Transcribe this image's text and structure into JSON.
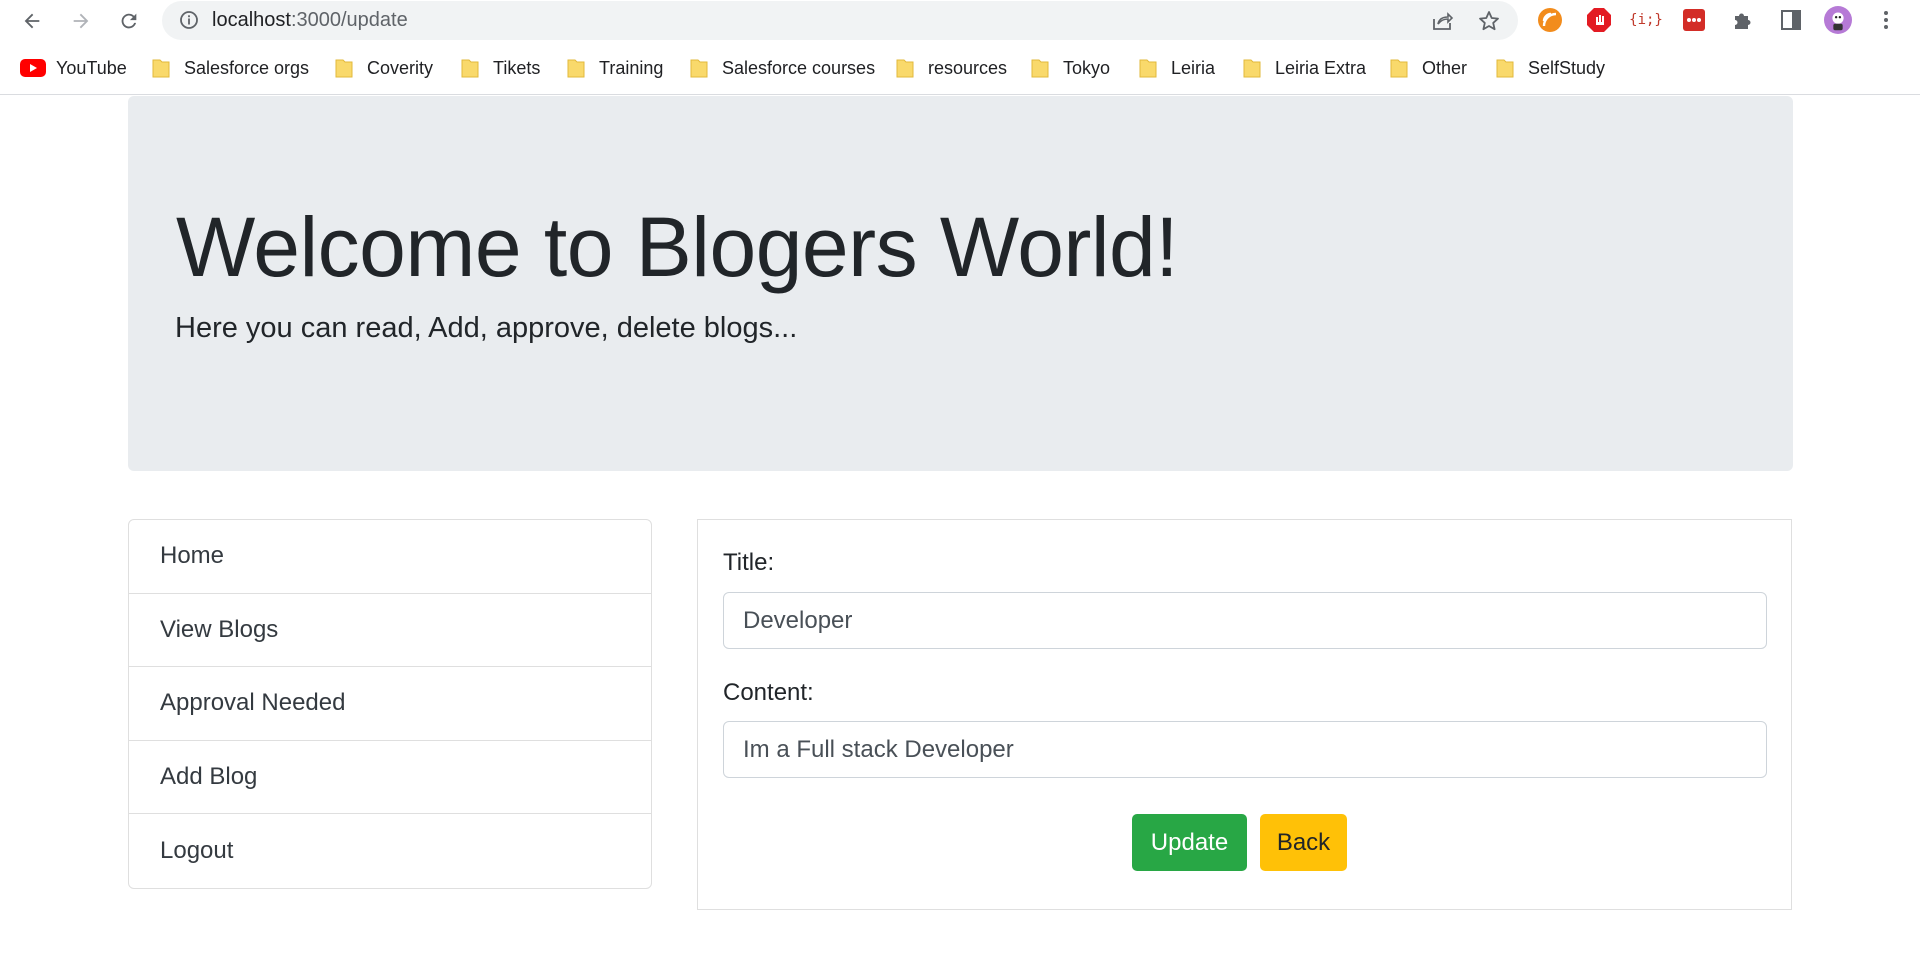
{
  "browser": {
    "url_host": "localhost",
    "url_path": ":3000/update",
    "bookmarks": [
      {
        "label": "YouTube",
        "icon": "youtube-icon"
      },
      {
        "label": "Salesforce orgs",
        "icon": "folder-icon"
      },
      {
        "label": "Coverity",
        "icon": "folder-icon"
      },
      {
        "label": "Tikets",
        "icon": "folder-icon"
      },
      {
        "label": "Training",
        "icon": "folder-icon"
      },
      {
        "label": "Salesforce courses",
        "icon": "folder-icon"
      },
      {
        "label": "resources",
        "icon": "folder-icon"
      },
      {
        "label": "Tokyo",
        "icon": "folder-icon"
      },
      {
        "label": "Leiria",
        "icon": "folder-icon"
      },
      {
        "label": "Leiria Extra",
        "icon": "folder-icon"
      },
      {
        "label": "Other",
        "icon": "folder-icon"
      },
      {
        "label": "SelfStudy",
        "icon": "folder-icon"
      }
    ],
    "extension_text": "{i;}"
  },
  "jumbotron": {
    "title": "Welcome to Blogers World!",
    "subtitle": "Here you can read, Add, approve, delete blogs..."
  },
  "sidebar": {
    "items": [
      {
        "label": "Home"
      },
      {
        "label": "View Blogs"
      },
      {
        "label": "Approval Needed"
      },
      {
        "label": "Add Blog"
      },
      {
        "label": "Logout"
      }
    ]
  },
  "form": {
    "title_label": "Title:",
    "title_value": "Developer",
    "content_label": "Content:",
    "content_value": "Im a Full stack Developer",
    "update_label": "Update",
    "back_label": "Back"
  },
  "colors": {
    "jumbotron_bg": "#e9ecef",
    "update_btn": "#28a745",
    "back_btn": "#ffc107"
  }
}
